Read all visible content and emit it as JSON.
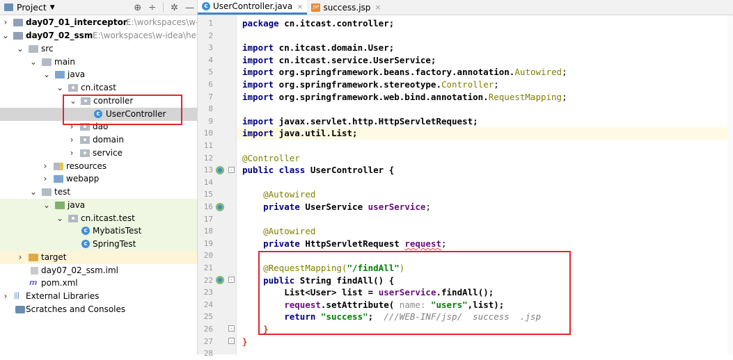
{
  "project_panel": {
    "title": "Project",
    "items": [
      {
        "label": "day07_01_interceptor",
        "path": "E:\\workspaces\\w-ide"
      },
      {
        "label": "day07_02_ssm",
        "path": "E:\\workspaces\\w-idea\\heima"
      },
      {
        "label": "src"
      },
      {
        "label": "main"
      },
      {
        "label": "java"
      },
      {
        "label": "cn.itcast"
      },
      {
        "label": "controller"
      },
      {
        "label": "UserController"
      },
      {
        "label": "dao"
      },
      {
        "label": "domain"
      },
      {
        "label": "service"
      },
      {
        "label": "resources"
      },
      {
        "label": "webapp"
      },
      {
        "label": "test"
      },
      {
        "label": "java"
      },
      {
        "label": "cn.itcast.test"
      },
      {
        "label": "MybatisTest"
      },
      {
        "label": "SpringTest"
      },
      {
        "label": "target"
      },
      {
        "label": "day07_02_ssm.iml"
      },
      {
        "label": "pom.xml"
      },
      {
        "label": "External Libraries"
      },
      {
        "label": "Scratches and Consoles"
      }
    ]
  },
  "editor": {
    "tabs": [
      {
        "label": "UserController.java",
        "active": true
      },
      {
        "label": "success.jsp",
        "active": false
      }
    ],
    "line_numbers": [
      "1",
      "2",
      "3",
      "4",
      "5",
      "6",
      "7",
      "8",
      "9",
      "10",
      "11",
      "12",
      "13",
      "14",
      "15",
      "16",
      "17",
      "18",
      "19",
      "20",
      "21",
      "22",
      "23",
      "24",
      "25",
      "26",
      "27",
      "28"
    ],
    "code": {
      "l1_kw": "package",
      "l1_rest": " cn.itcast.controller;",
      "l3_kw": "import",
      "l3_rest": " cn.itcast.domain.User;",
      "l4_kw": "import",
      "l4_rest": " cn.itcast.service.UserService;",
      "l5_kw": "import",
      "l5_rest": " org.springframework.beans.factory.annotation.",
      "l5_cls": "Autowired",
      "l5_end": ";",
      "l6_kw": "import",
      "l6_rest": " org.springframework.stereotype.",
      "l6_cls": "Controller",
      "l6_end": ";",
      "l7_kw": "import",
      "l7_rest": " org.springframework.web.bind.annotation.",
      "l7_cls": "RequestMapping",
      "l7_end": ";",
      "l9_kw": "import",
      "l9_rest": " javax.servlet.http.HttpServletRequest;",
      "l10_kw": "import",
      "l10_rest": " java.util.List;",
      "l12_an": "@Controller",
      "l13_kw": "public class",
      "l13_rest": " UserController {",
      "l15_an": "@Autowired",
      "l16_kw": "private",
      "l16_type": " UserService ",
      "l16_fld": "userService",
      "l16_end": ";",
      "l18_an": "@Autowired",
      "l19_kw": "private",
      "l19_type": " HttpServletRequest ",
      "l19_fld": "request",
      "l19_end": ";",
      "l21_an": "@RequestMapping(",
      "l21_str": "\"/findAll\"",
      "l21_end": ")",
      "l22_kw": "public",
      "l22_rest": " String findAll() {",
      "l23_a": "List<User> list = ",
      "l23_fld": "userService",
      "l23_b": ".findAll();",
      "l24_fld": "request",
      "l24_a": ".setAttribute( ",
      "l24_hint": "name:",
      "l24_str": " \"users\"",
      "l24_b": ",list);",
      "l25_kw": "return",
      "l25_str": " \"success\"",
      "l25_a": ";  ",
      "l25_cmt": "///WEB-INF/jsp/  success  .jsp",
      "l26": "}",
      "l27": "}"
    }
  }
}
